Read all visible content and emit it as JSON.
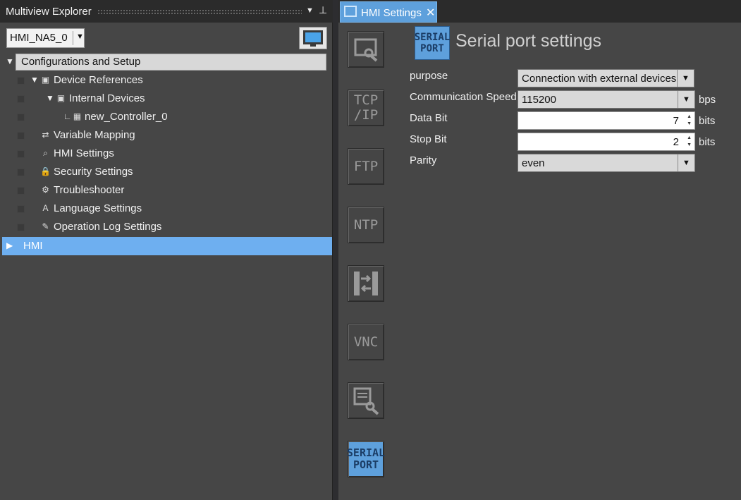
{
  "explorer": {
    "title": "Multiview Explorer",
    "device": "HMI_NA5_0",
    "tree": {
      "config": "Configurations and Setup",
      "device_refs": "Device References",
      "internal_devices": "Internal Devices",
      "controller": "new_Controller_0",
      "variable_mapping": "Variable Mapping",
      "hmi_settings": "HMI Settings",
      "security_settings": "Security Settings",
      "troubleshooter": "Troubleshooter",
      "language_settings": "Language Settings",
      "operation_log": "Operation Log Settings",
      "hmi": "HMI"
    }
  },
  "tab": {
    "label": "HMI Settings"
  },
  "categories": {
    "tcpip": "TCP\n/IP",
    "ftp": "FTP",
    "ntp": "NTP",
    "vnc": "VNC",
    "serial": "SERIAL\nPORT"
  },
  "panel": {
    "icon_text": "SERIAL\nPORT",
    "title": "Serial port settings",
    "fields": {
      "purpose_label": "purpose",
      "purpose_value": "Connection with external devices",
      "speed_label": "Communication Speed",
      "speed_value": "115200",
      "speed_unit": "bps",
      "databit_label": "Data Bit",
      "databit_value": "7",
      "databit_unit": "bits",
      "stopbit_label": "Stop Bit",
      "stopbit_value": "2",
      "stopbit_unit": "bits",
      "parity_label": "Parity",
      "parity_value": "even"
    }
  },
  "colors": {
    "accent": "#5ea0dc",
    "selection": "#6eaff0",
    "background": "#464646"
  }
}
